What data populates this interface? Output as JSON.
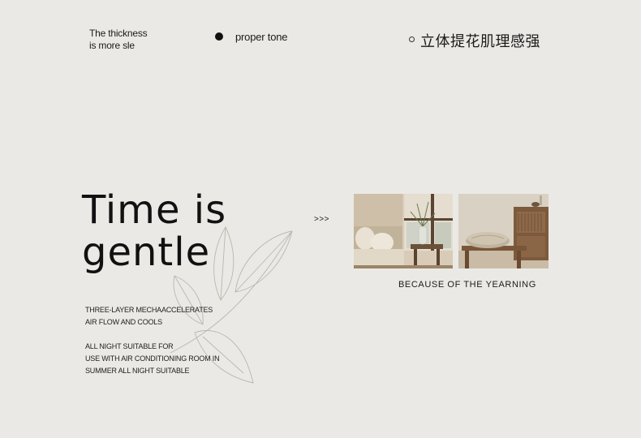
{
  "header": {
    "thickness_line1": "The thickness",
    "thickness_line2": "is more sle",
    "proper_tone": "proper tone",
    "zh_title": "立体提花肌理感强"
  },
  "headline": {
    "line1": "Time  is",
    "line2": "gentle"
  },
  "body": {
    "line1": "THREE-LAYER MECHAACCELERATES",
    "line2": "AIR FLOW AND COOLS",
    "line3": "ALL NIGHT SUITABLE FOR",
    "line4": "USE WITH AIR CONDITIONING ROOM IN",
    "line5": "SUMMER ALL NIGHT SUITABLE"
  },
  "arrows": ">>>",
  "caption": "BECAUSE  OF  THE  YEARNING",
  "colors": {
    "background": "#ebe9e5",
    "text": "#1b1b1b"
  }
}
